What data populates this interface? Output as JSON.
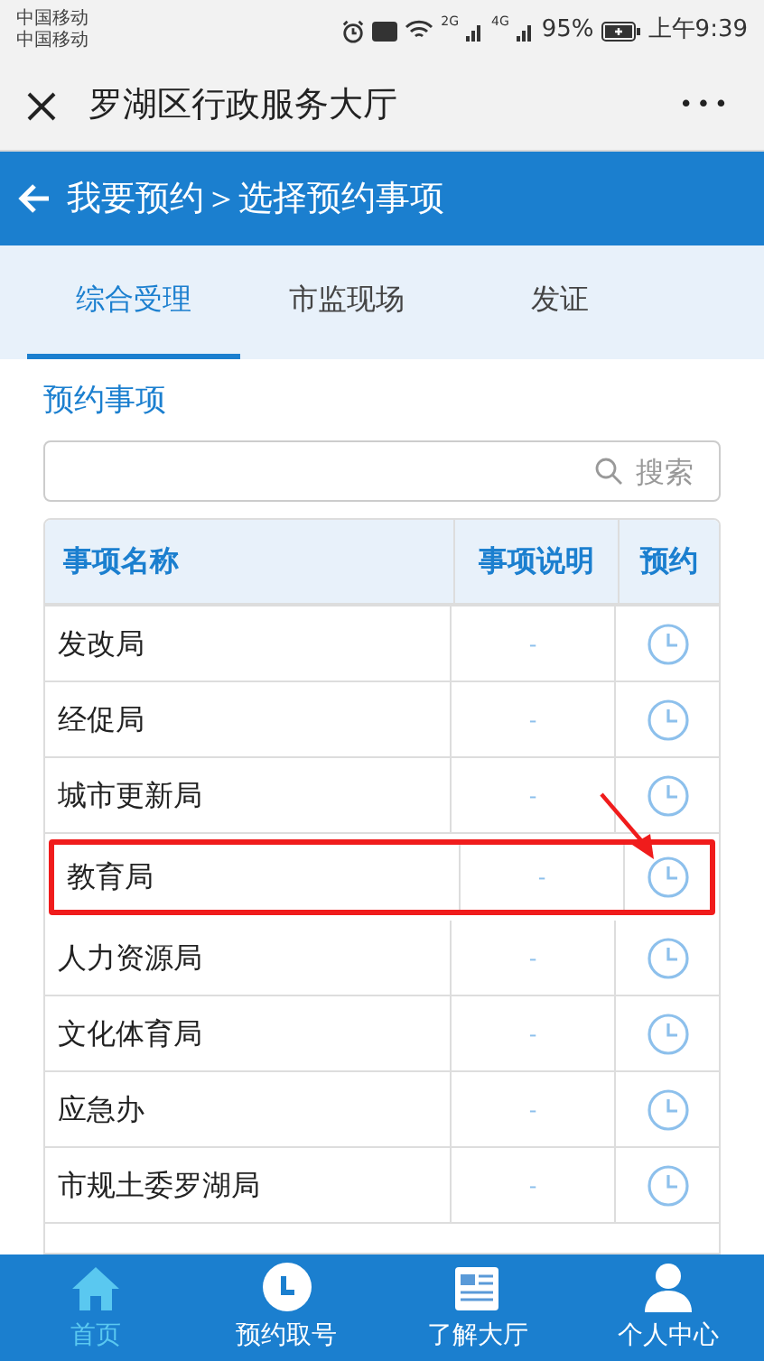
{
  "status_bar": {
    "carriers": [
      "中国移动",
      "中国移动"
    ],
    "network_1": "2G",
    "network_2": "4G",
    "battery": "95%",
    "time": "上午9:39"
  },
  "title_bar": {
    "title": "罗湖区行政服务大厅",
    "more": "•••"
  },
  "header": {
    "title": "我要预约＞选择预约事项"
  },
  "tabs": [
    {
      "label": "综合受理",
      "selected": true
    },
    {
      "label": "市监现场",
      "selected": false
    },
    {
      "label": "发证",
      "selected": false
    }
  ],
  "section_title": "预约事项",
  "search": {
    "placeholder": "搜索"
  },
  "table": {
    "columns": [
      "事项名称",
      "事项说明",
      "预约"
    ],
    "rows": [
      {
        "name": "发改局",
        "note": "-",
        "highlighted": false
      },
      {
        "name": "经促局",
        "note": "-",
        "highlighted": false
      },
      {
        "name": "城市更新局",
        "note": "-",
        "highlighted": false
      },
      {
        "name": "教育局",
        "note": "-",
        "highlighted": true
      },
      {
        "name": "人力资源局",
        "note": "-",
        "highlighted": false
      },
      {
        "name": "文化体育局",
        "note": "-",
        "highlighted": false
      },
      {
        "name": "应急办",
        "note": "-",
        "highlighted": false
      },
      {
        "name": "市规土委罗湖局",
        "note": "-",
        "highlighted": false
      }
    ]
  },
  "bottom_nav": [
    {
      "label": "首页",
      "selected": true,
      "kind": "home"
    },
    {
      "label": "预约取号",
      "selected": false,
      "kind": "clock"
    },
    {
      "label": "了解大厅",
      "selected": false,
      "kind": "news"
    },
    {
      "label": "个人中心",
      "selected": false,
      "kind": "person"
    }
  ]
}
